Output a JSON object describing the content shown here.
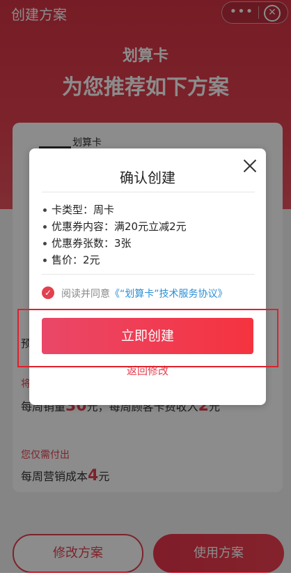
{
  "topbar": {
    "title": "创建方案",
    "more_icon": "•••",
    "close_icon": "⊗"
  },
  "hero": {
    "subtitle": "划算卡",
    "headline": "为您推荐如下方案"
  },
  "plan_card": {
    "name_suffix": "划算卡",
    "estimate_label": "将",
    "estimate_text_prefix": "每周销量",
    "estimate_value": "30",
    "estimate_text_mid": "元，每周顾客卡费收入",
    "estimate_value2": "2",
    "estimate_text_suffix": "元",
    "line_a": "预",
    "pay_label": "您仅需付出",
    "pay_text_prefix": "每周营销成本",
    "pay_value": "4",
    "pay_text_suffix": "元"
  },
  "bottom_buttons": {
    "modify": "修改方案",
    "use": "使用方案"
  },
  "modal": {
    "title": "确认创建",
    "items": [
      "卡类型：周卡",
      "优惠券内容：满20元立减2元",
      "优惠券张数：3张",
      "售价：2元"
    ],
    "agree_prefix": "阅读并同意",
    "agree_link": "《“划算卡”技术服务协议》",
    "confirm_button": "立即创建",
    "back_link": "返回修改"
  },
  "colors": {
    "accent": "#e3404f",
    "link": "#2a8fd6",
    "highlight": "#e0202a"
  }
}
